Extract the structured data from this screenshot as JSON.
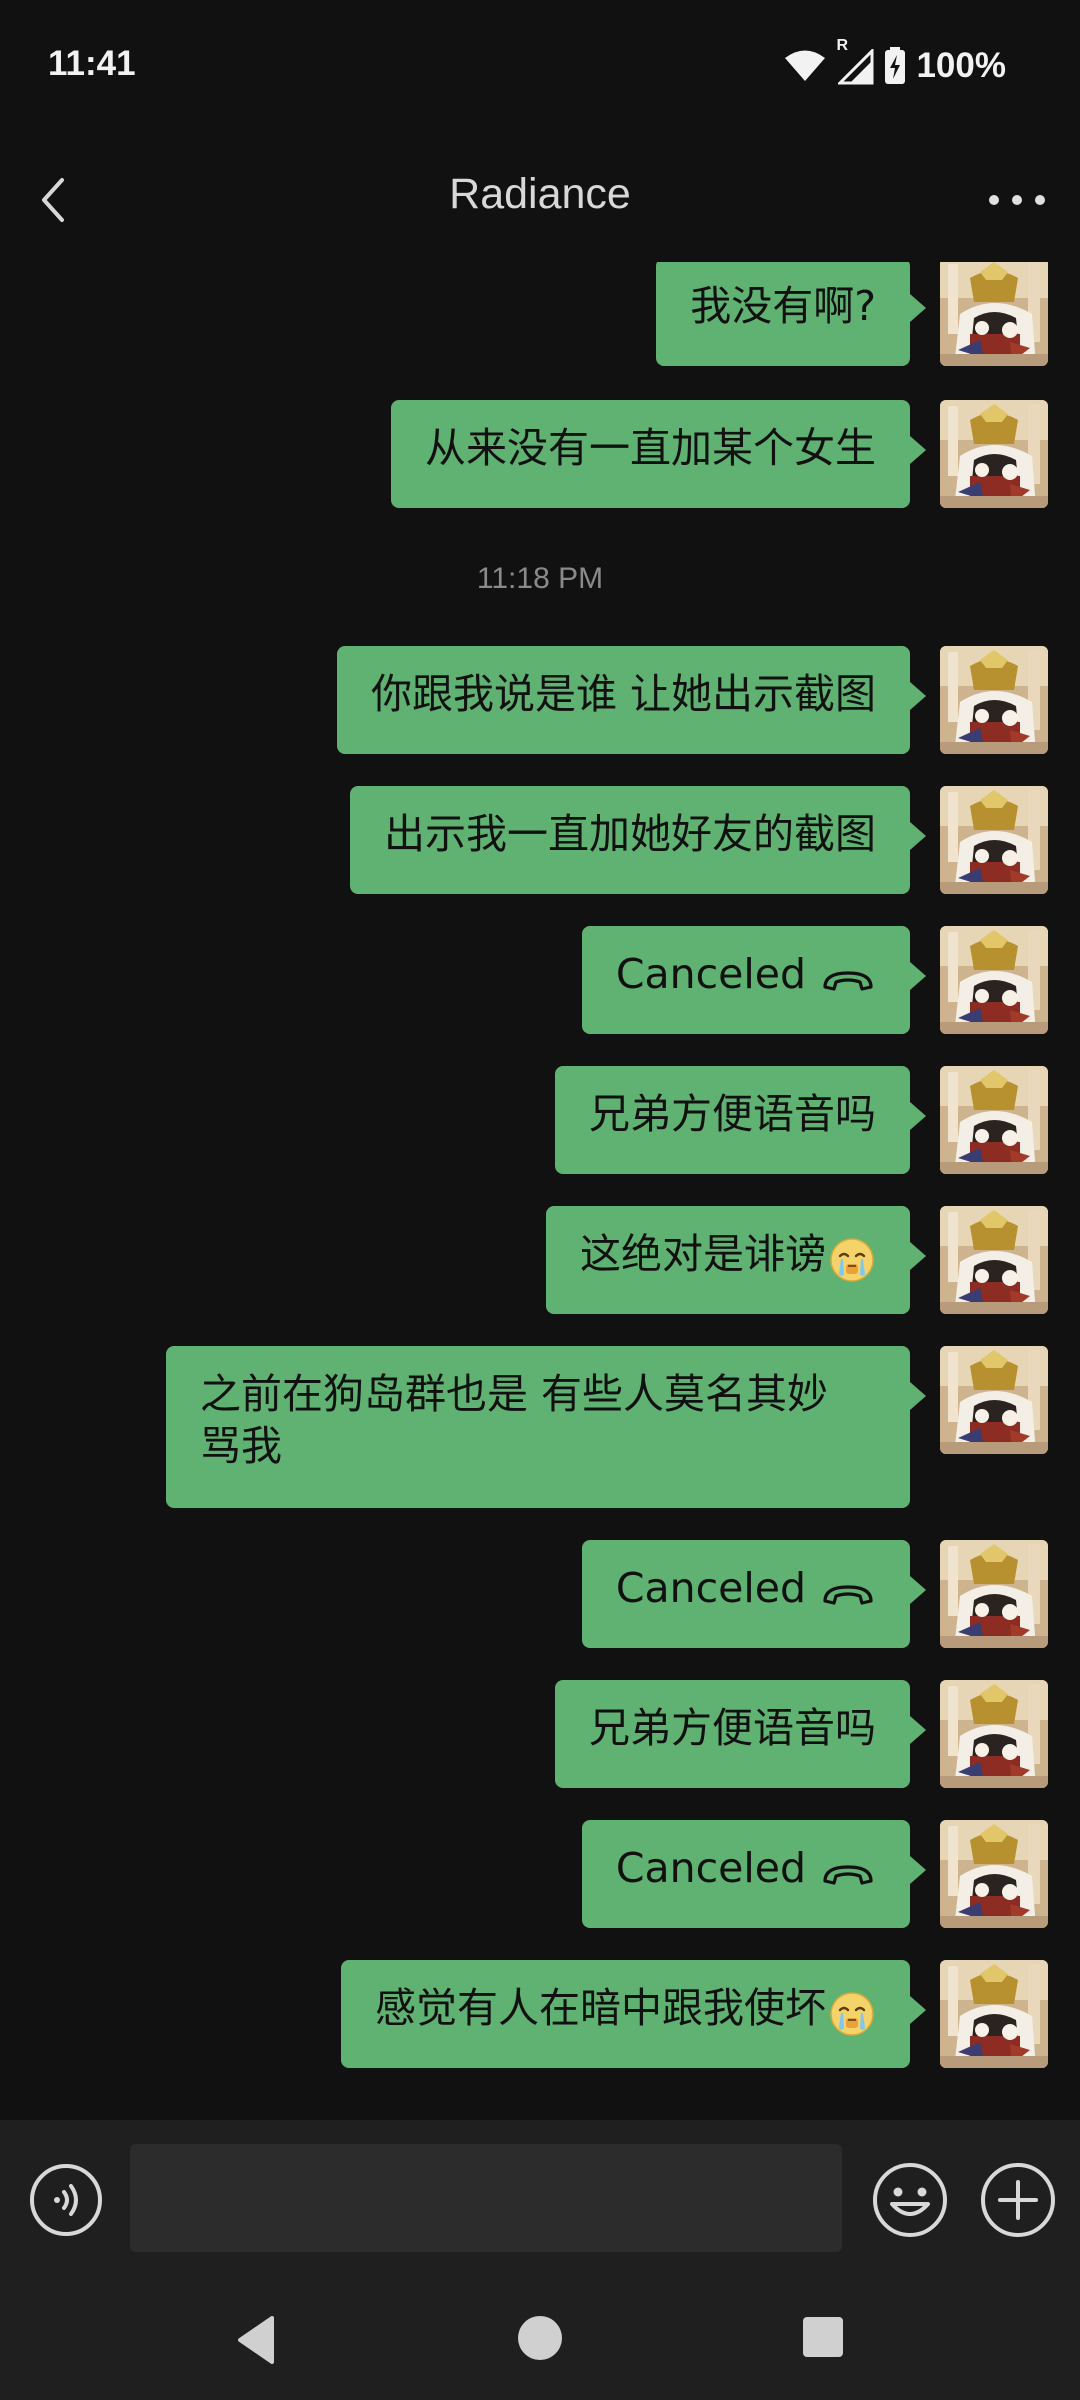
{
  "status_bar": {
    "time": "11:41",
    "roaming_indicator": "R",
    "battery": "100%",
    "icons": [
      "wifi-icon",
      "signal-icon",
      "battery-charging-icon"
    ]
  },
  "header": {
    "title": "Radiance",
    "back_icon": "back-chevron-icon",
    "more_icon": "more-dots-icon"
  },
  "messages": [
    {
      "type": "text",
      "side": "right",
      "text": "我没有啊?"
    },
    {
      "type": "text",
      "side": "right",
      "text": "从来没有一直加某个女生"
    },
    {
      "type": "timestamp",
      "text": "11:18 PM"
    },
    {
      "type": "text",
      "side": "right",
      "text": "你跟我说是谁 让她出示截图"
    },
    {
      "type": "text",
      "side": "right",
      "text": "出示我一直加她好友的截图"
    },
    {
      "type": "call",
      "side": "right",
      "text": "Canceled",
      "icon": "phone-hangup-icon"
    },
    {
      "type": "text",
      "side": "right",
      "text": "兄弟方便语音吗"
    },
    {
      "type": "text",
      "side": "right",
      "text": "这绝对是诽谤",
      "emoji": "crying-face-emoji"
    },
    {
      "type": "text",
      "side": "right",
      "text": "之前在狗岛群也是 有些人莫名其妙\n骂我"
    },
    {
      "type": "call",
      "side": "right",
      "text": "Canceled",
      "icon": "phone-hangup-icon"
    },
    {
      "type": "text",
      "side": "right",
      "text": "兄弟方便语音吗"
    },
    {
      "type": "call",
      "side": "right",
      "text": "Canceled",
      "icon": "phone-hangup-icon"
    },
    {
      "type": "text",
      "side": "right",
      "text": "感觉有人在暗中跟我使坏",
      "emoji": "crying-face-emoji"
    }
  ],
  "input_bar": {
    "voice_icon": "voice-input-icon",
    "input_value": "",
    "input_placeholder": "",
    "emoji_icon": "emoji-icon",
    "plus_icon": "plus-icon"
  },
  "nav_bar": {
    "icons": [
      "nav-back-icon",
      "nav-home-icon",
      "nav-recents-icon"
    ]
  },
  "colors": {
    "background": "#111111",
    "bubble": "#5fb271",
    "bubble_text": "#111111",
    "bar_background": "#1f1f1f"
  }
}
